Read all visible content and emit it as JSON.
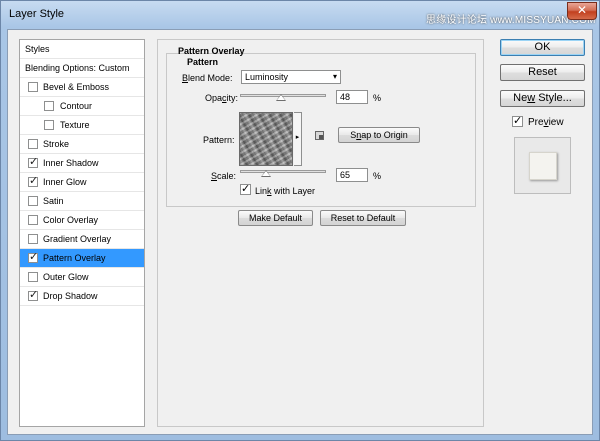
{
  "window": {
    "title": "Layer Style",
    "watermark": "思缘设计论坛 www.MISSYUAN.COM",
    "close_symbol": "✕"
  },
  "styles_list": [
    {
      "label": "Styles",
      "type": "header",
      "checked": false,
      "selected": false
    },
    {
      "label": "Blending Options: Custom",
      "type": "header",
      "checked": false,
      "selected": false
    },
    {
      "label": "Bevel & Emboss",
      "type": "item",
      "checked": false,
      "selected": false
    },
    {
      "label": "Contour",
      "type": "sub",
      "checked": false,
      "selected": false
    },
    {
      "label": "Texture",
      "type": "sub",
      "checked": false,
      "selected": false
    },
    {
      "label": "Stroke",
      "type": "item",
      "checked": false,
      "selected": false
    },
    {
      "label": "Inner Shadow",
      "type": "item",
      "checked": true,
      "selected": false
    },
    {
      "label": "Inner Glow",
      "type": "item",
      "checked": true,
      "selected": false
    },
    {
      "label": "Satin",
      "type": "item",
      "checked": false,
      "selected": false
    },
    {
      "label": "Color Overlay",
      "type": "item",
      "checked": false,
      "selected": false
    },
    {
      "label": "Gradient Overlay",
      "type": "item",
      "checked": false,
      "selected": false
    },
    {
      "label": "Pattern Overlay",
      "type": "item",
      "checked": true,
      "selected": true
    },
    {
      "label": "Outer Glow",
      "type": "item",
      "checked": false,
      "selected": false
    },
    {
      "label": "Drop Shadow",
      "type": "item",
      "checked": true,
      "selected": false
    }
  ],
  "panel": {
    "section_title": "Pattern Overlay",
    "group_title": "Pattern",
    "blend_mode": {
      "label_pre": "",
      "label_key": "B",
      "label_post": "lend Mode:",
      "value": "Luminosity"
    },
    "opacity": {
      "label_pre": "Opa",
      "label_key": "c",
      "label_post": "ity:",
      "value": "48",
      "unit": "%",
      "fraction": 0.48
    },
    "pattern": {
      "label": "Pattern:"
    },
    "snap_button": {
      "pre": "S",
      "key": "n",
      "post": "ap to Origin"
    },
    "scale": {
      "label_pre": "",
      "label_key": "S",
      "label_post": "cale:",
      "value": "65",
      "unit": "%",
      "fraction": 0.3
    },
    "link": {
      "pre": "Lin",
      "key": "k",
      "post": " with Layer",
      "checked": true
    },
    "make_default": "Make Default",
    "reset_default": "Reset to Default"
  },
  "right": {
    "ok": "OK",
    "reset": "Reset",
    "new_style": {
      "pre": "Ne",
      "key": "w",
      "post": " Style..."
    },
    "preview": {
      "pre": "Pre",
      "key": "v",
      "post": "iew",
      "checked": true
    }
  },
  "colors": {
    "selection": "#3399ff",
    "titlebar": "#a9c6e6"
  },
  "icons": {
    "check": "✓",
    "dropdown": "▾",
    "swatch_menu": "▸"
  }
}
